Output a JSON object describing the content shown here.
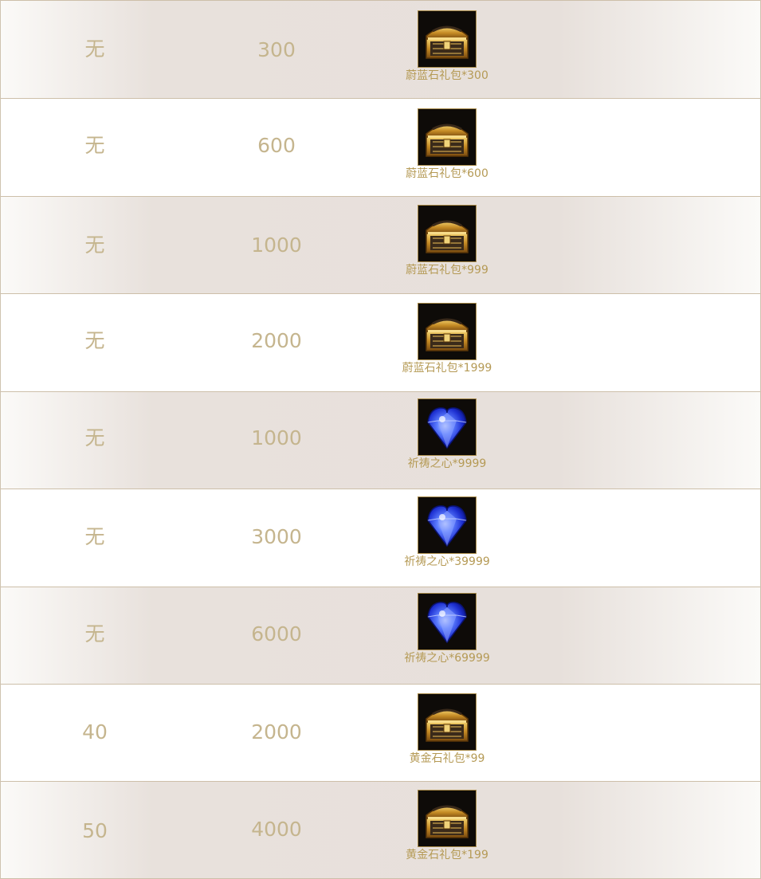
{
  "rows": [
    {
      "level": "无",
      "points": "300",
      "reward_icon": "treasure-chest-icon",
      "reward_label": "蔚蓝石礼包*300"
    },
    {
      "level": "无",
      "points": "600",
      "reward_icon": "treasure-chest-icon",
      "reward_label": "蔚蓝石礼包*600"
    },
    {
      "level": "无",
      "points": "1000",
      "reward_icon": "treasure-chest-icon",
      "reward_label": "蔚蓝石礼包*999"
    },
    {
      "level": "无",
      "points": "2000",
      "reward_icon": "treasure-chest-icon",
      "reward_label": "蔚蓝石礼包*1999"
    },
    {
      "level": "无",
      "points": "1000",
      "reward_icon": "blue-gem-icon",
      "reward_label": "祈祷之心*9999"
    },
    {
      "level": "无",
      "points": "3000",
      "reward_icon": "blue-gem-icon",
      "reward_label": "祈祷之心*39999"
    },
    {
      "level": "无",
      "points": "6000",
      "reward_icon": "blue-gem-icon",
      "reward_label": "祈祷之心*69999"
    },
    {
      "level": "40",
      "points": "2000",
      "reward_icon": "treasure-chest-icon",
      "reward_label": "黄金石礼包*99"
    },
    {
      "level": "50",
      "points": "4000",
      "reward_icon": "treasure-chest-icon",
      "reward_label": "黄金石礼包*199"
    }
  ],
  "colors": {
    "text_gold": "#c5b58e",
    "label_gold": "#b59a55",
    "row_shade": "#e7e0db",
    "border": "#cdbfa9"
  }
}
